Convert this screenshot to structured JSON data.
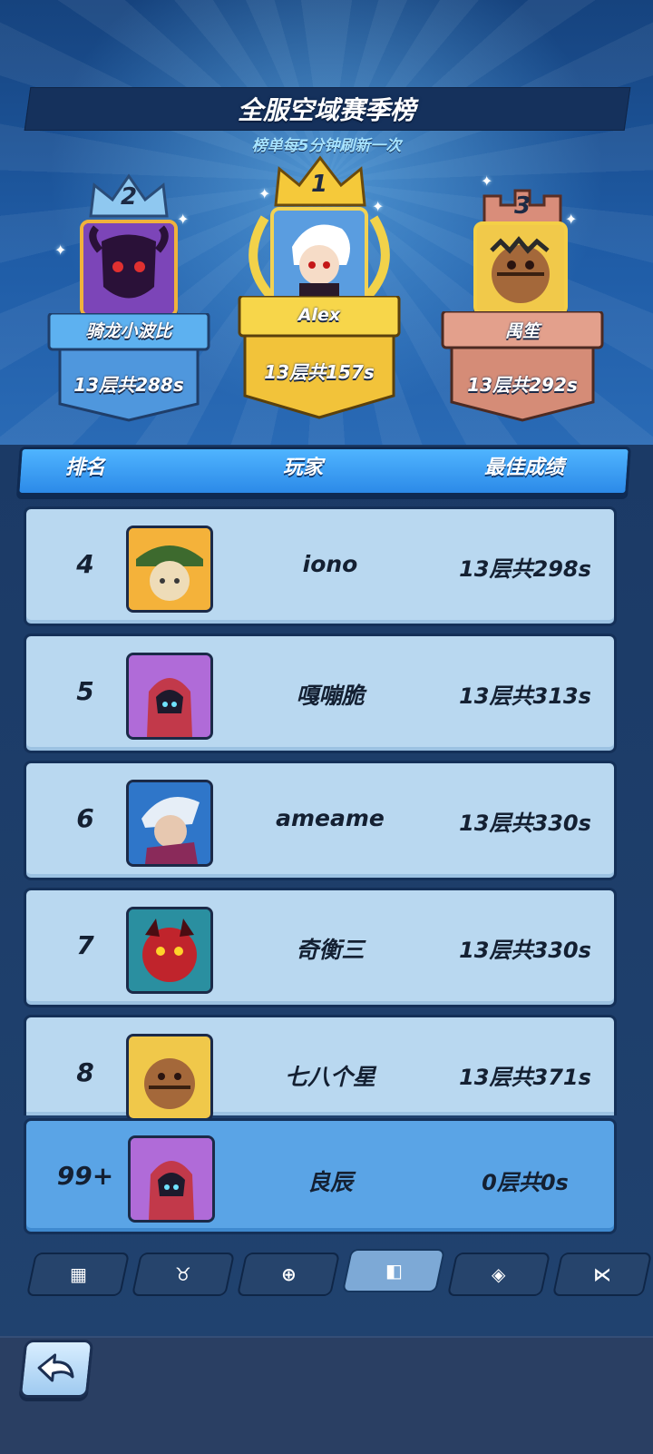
{
  "header": {
    "title": "全服空域赛季榜",
    "subtitle": "榜单每5分钟刷新一次"
  },
  "podium": [
    {
      "rank": "2",
      "name": "骑龙小波比",
      "score": "13层共288s",
      "avatar_icon": "demon-mask-avatar-icon"
    },
    {
      "rank": "1",
      "name": "Alex",
      "score": "13层共157s",
      "avatar_icon": "white-hair-hero-avatar-icon"
    },
    {
      "rank": "3",
      "name": "禺笙",
      "score": "13层共292s",
      "avatar_icon": "pumpkin-monster-avatar-icon"
    }
  ],
  "table": {
    "headers": {
      "rank": "排名",
      "player": "玩家",
      "best": "最佳成绩"
    },
    "rows": [
      {
        "rank": "4",
        "name": "iono",
        "score": "13层共298s"
      },
      {
        "rank": "5",
        "name": "嘎嘣脆",
        "score": "13层共313s"
      },
      {
        "rank": "6",
        "name": "ameame",
        "score": "13层共330s"
      },
      {
        "rank": "7",
        "name": "奇衡三",
        "score": "13层共330s"
      },
      {
        "rank": "8",
        "name": "七八个星",
        "score": "13层共371s"
      }
    ],
    "self": {
      "rank": "99+",
      "name": "良辰",
      "score": "0层共0s"
    }
  },
  "tabs": [
    {
      "icon": "tower-icon",
      "glyph": "▦"
    },
    {
      "icon": "bull-icon",
      "glyph": "♉"
    },
    {
      "icon": "shield-plus-icon",
      "glyph": "⊕"
    },
    {
      "icon": "cards-icon",
      "glyph": "◧"
    },
    {
      "icon": "emblem-icon",
      "glyph": "◈"
    },
    {
      "icon": "branch-icon",
      "glyph": "⋉"
    }
  ],
  "colors": {
    "gold": "#f5c93a",
    "silver": "#6fb8ee",
    "bronze": "#d78a76",
    "row_bg": "#b9d8f0",
    "self_row_bg": "#5aa4e6"
  }
}
